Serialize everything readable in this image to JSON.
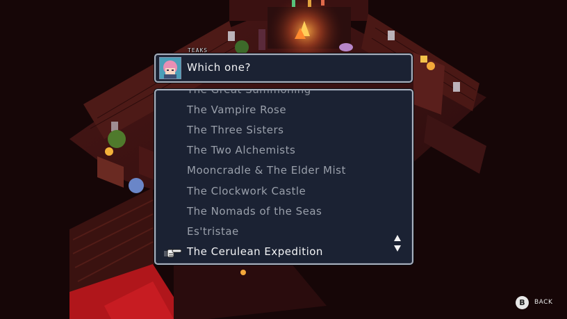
{
  "dialog": {
    "speaker": "TEAKS",
    "text": "Which one?"
  },
  "choices": {
    "partial_item": "The Great Summoning",
    "items": [
      "The Vampire Rose",
      "The Three Sisters",
      "The Two Alchemists",
      "Mooncradle & The Elder Mist",
      "The Clockwork Castle",
      "The Nomads of the Seas",
      "Es'tristae",
      "The Cerulean Expedition"
    ],
    "selected_index": 7
  },
  "controls": {
    "back_button_glyph": "B",
    "back_label": "BACK"
  },
  "icons": {
    "pointer": "pointing-hand-icon",
    "scroll": "scroll-arrows-icon"
  },
  "colors": {
    "panel_bg": "#1b2233",
    "panel_border": "#a9b0bd",
    "text_selected": "#f4f5f7",
    "text_unselected": "#9aa0ab"
  }
}
